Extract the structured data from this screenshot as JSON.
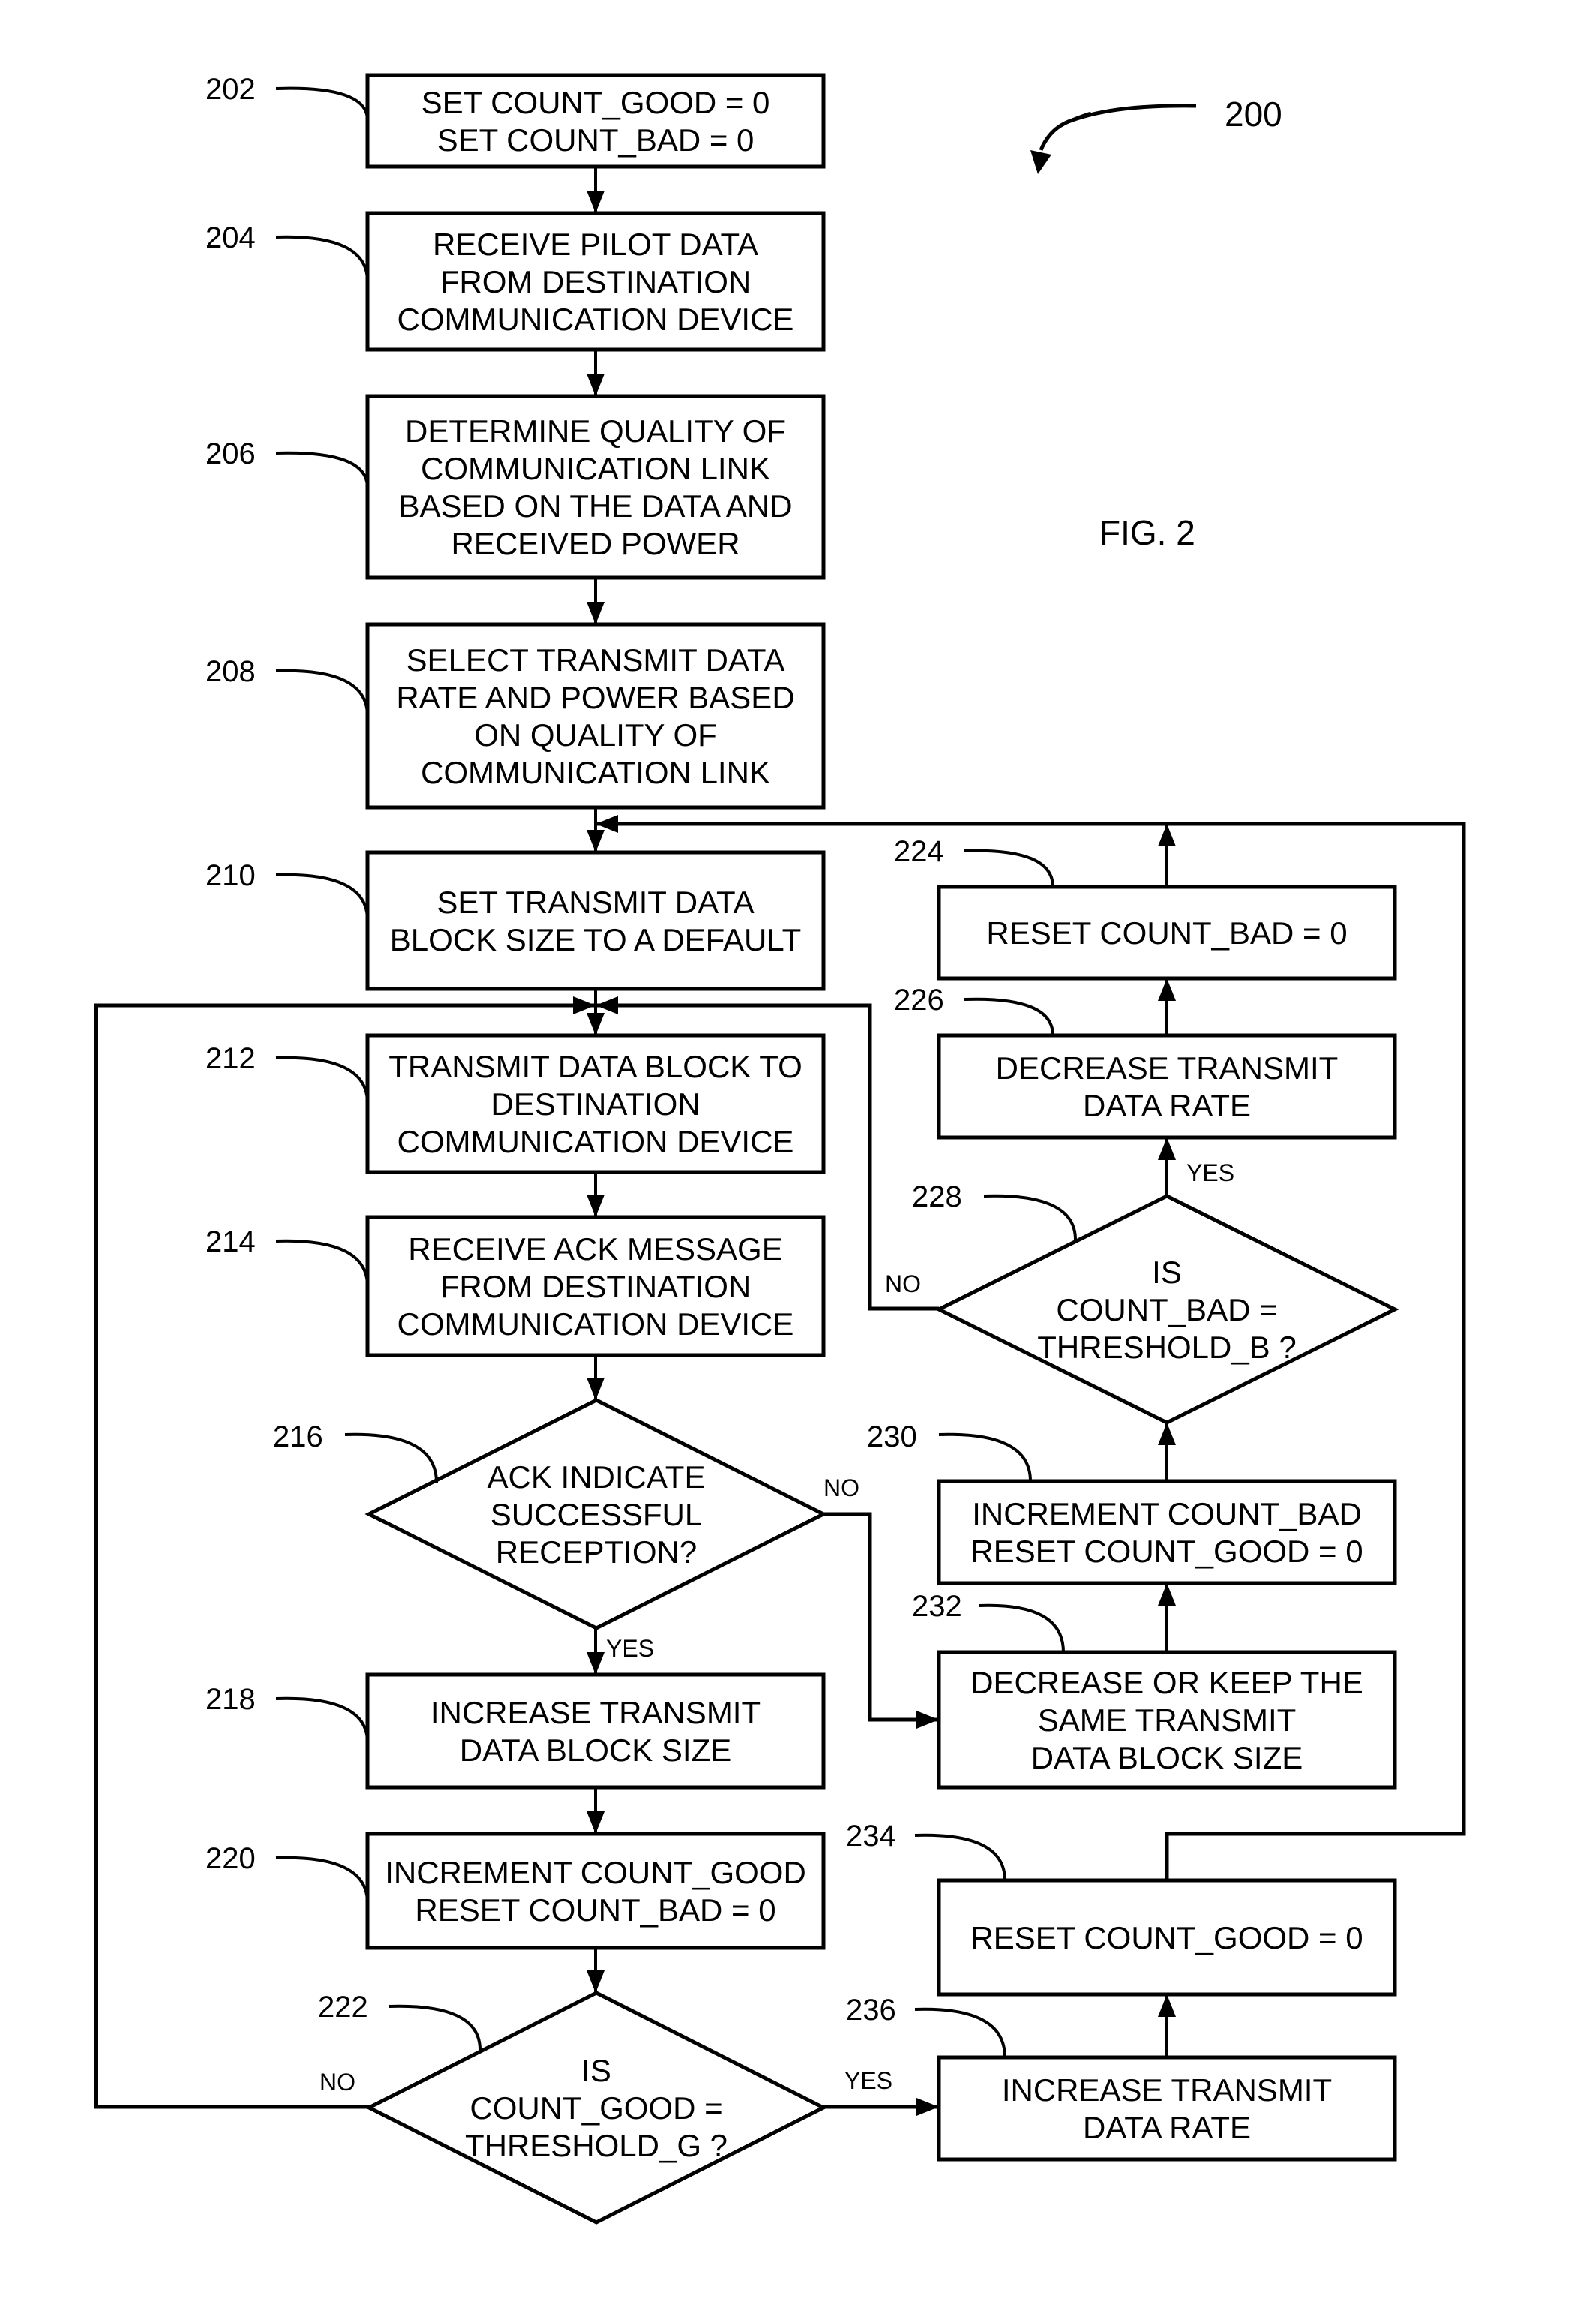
{
  "figure": {
    "label": "FIG. 2",
    "reference_number": "200"
  },
  "nodes": [
    {
      "id": "202",
      "type": "process",
      "lines": [
        "SET COUNT_GOOD  = 0",
        "SET COUNT_BAD = 0"
      ]
    },
    {
      "id": "204",
      "type": "process",
      "lines": [
        "RECEIVE PILOT DATA",
        "FROM DESTINATION",
        "COMMUNICATION DEVICE"
      ]
    },
    {
      "id": "206",
      "type": "process",
      "lines": [
        "DETERMINE QUALITY OF",
        "COMMUNICATION LINK",
        "BASED ON THE DATA AND",
        "RECEIVED POWER"
      ]
    },
    {
      "id": "208",
      "type": "process",
      "lines": [
        "SELECT TRANSMIT DATA",
        "RATE AND POWER BASED",
        "ON QUALITY OF",
        "COMMUNICATION LINK"
      ]
    },
    {
      "id": "210",
      "type": "process",
      "lines": [
        "SET TRANSMIT DATA",
        "BLOCK SIZE TO A DEFAULT"
      ]
    },
    {
      "id": "212",
      "type": "process",
      "lines": [
        "TRANSMIT DATA BLOCK TO",
        "DESTINATION",
        "COMMUNICATION DEVICE"
      ]
    },
    {
      "id": "214",
      "type": "process",
      "lines": [
        "RECEIVE ACK MESSAGE",
        "FROM DESTINATION",
        "COMMUNICATION DEVICE"
      ]
    },
    {
      "id": "216",
      "type": "decision",
      "lines": [
        "ACK INDICATE",
        "SUCCESSFUL",
        "RECEPTION?"
      ]
    },
    {
      "id": "218",
      "type": "process",
      "lines": [
        "INCREASE TRANSMIT",
        "DATA BLOCK SIZE"
      ]
    },
    {
      "id": "220",
      "type": "process",
      "lines": [
        "INCREMENT COUNT_GOOD",
        "RESET COUNT_BAD = 0"
      ]
    },
    {
      "id": "222",
      "type": "decision",
      "lines": [
        "IS",
        "COUNT_GOOD =",
        "THRESHOLD_G ?"
      ]
    },
    {
      "id": "224",
      "type": "process",
      "lines": [
        "RESET COUNT_BAD = 0"
      ]
    },
    {
      "id": "226",
      "type": "process",
      "lines": [
        "DECREASE TRANSMIT",
        "DATA RATE"
      ]
    },
    {
      "id": "228",
      "type": "decision",
      "lines": [
        "IS",
        "COUNT_BAD =",
        "THRESHOLD_B ?"
      ]
    },
    {
      "id": "230",
      "type": "process",
      "lines": [
        "INCREMENT COUNT_BAD",
        "RESET COUNT_GOOD = 0"
      ]
    },
    {
      "id": "232",
      "type": "process",
      "lines": [
        "DECREASE OR KEEP THE",
        "SAME TRANSMIT",
        "DATA BLOCK SIZE"
      ]
    },
    {
      "id": "234",
      "type": "process",
      "lines": [
        "RESET COUNT_GOOD = 0"
      ]
    },
    {
      "id": "236",
      "type": "process",
      "lines": [
        "INCREASE TRANSMIT",
        "DATA RATE"
      ]
    }
  ],
  "edges": [
    {
      "from": "202",
      "to": "204",
      "label": ""
    },
    {
      "from": "204",
      "to": "206",
      "label": ""
    },
    {
      "from": "206",
      "to": "208",
      "label": ""
    },
    {
      "from": "208",
      "to": "210",
      "label": ""
    },
    {
      "from": "210",
      "to": "212",
      "label": ""
    },
    {
      "from": "212",
      "to": "214",
      "label": ""
    },
    {
      "from": "214",
      "to": "216",
      "label": ""
    },
    {
      "from": "216",
      "to": "218",
      "label": "YES"
    },
    {
      "from": "216",
      "to": "232",
      "label": "NO"
    },
    {
      "from": "218",
      "to": "220",
      "label": ""
    },
    {
      "from": "220",
      "to": "222",
      "label": ""
    },
    {
      "from": "222",
      "to": "212",
      "label": "NO"
    },
    {
      "from": "222",
      "to": "236",
      "label": "YES"
    },
    {
      "from": "236",
      "to": "234",
      "label": ""
    },
    {
      "from": "234",
      "to": "210",
      "label": ""
    },
    {
      "from": "232",
      "to": "230",
      "label": ""
    },
    {
      "from": "230",
      "to": "228",
      "label": ""
    },
    {
      "from": "228",
      "to": "226",
      "label": "YES"
    },
    {
      "from": "228",
      "to": "212",
      "label": "NO"
    },
    {
      "from": "226",
      "to": "224",
      "label": ""
    },
    {
      "from": "224",
      "to": "210",
      "label": ""
    }
  ],
  "edge_labels": {
    "yes": "YES",
    "no": "NO"
  },
  "colors": {
    "ink": "#000000",
    "paper": "#ffffff"
  }
}
